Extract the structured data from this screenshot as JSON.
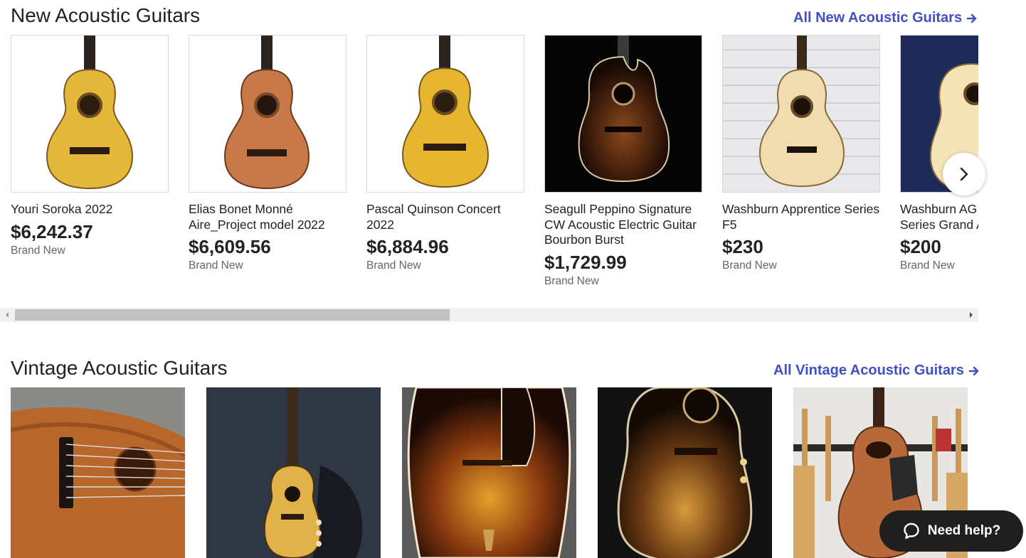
{
  "new_section": {
    "title": "New Acoustic Guitars",
    "see_all": "All New Acoustic Guitars",
    "items": [
      {
        "title": "Youri Soroka 2022",
        "price": "$6,242.37",
        "condition": "Brand New"
      },
      {
        "title": "Elias Bonet Monné Aire_Project model 2022",
        "price": "$6,609.56",
        "condition": "Brand New"
      },
      {
        "title": "Pascal Quinson Concert 2022",
        "price": "$6,884.96",
        "condition": "Brand New"
      },
      {
        "title": "Seagull Peppino Signature CW Acoustic Electric Guitar Bourbon Burst",
        "price": "$1,729.99",
        "condition": "Brand New"
      },
      {
        "title": "Washburn Apprentice Series F5",
        "price": "$230",
        "condition": "Brand New"
      },
      {
        "title": "Washburn AG Apprentice Series Grand Auditorium",
        "price": "$200",
        "condition": "Brand New"
      }
    ],
    "next_icon": "chevron-right-icon"
  },
  "vintage_section": {
    "title": "Vintage Acoustic Guitars",
    "see_all": "All Vintage Acoustic Guitars"
  },
  "help": {
    "label": "Need help?",
    "icon": "chat-bubble-icon"
  },
  "colors": {
    "link": "#3f51c4",
    "help_bg": "#1f1f1f"
  }
}
